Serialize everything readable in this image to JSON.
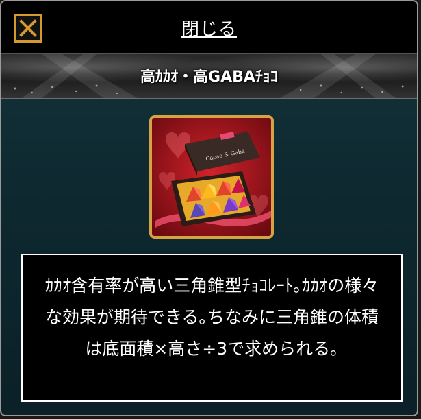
{
  "header": {
    "close_link_label": "閉じる",
    "close_icon": "close-x-icon",
    "accent_color": "#d49a2e"
  },
  "item": {
    "name": "高ｶｶｵ・高GABAﾁｮｺ",
    "image_icon": "chocolate-box-icon",
    "box_label": "Cacao & Gaba",
    "description": "ｶｶｵ含有率が高い三角錐型ﾁｮｺﾚｰﾄ｡ｶｶｵの様々な効果が期待できる｡ちなみに三角錐の体積は底面積×高さ÷3で求められる｡"
  },
  "colors": {
    "frame_gold": "#d6a344",
    "background": "#0e2930"
  }
}
